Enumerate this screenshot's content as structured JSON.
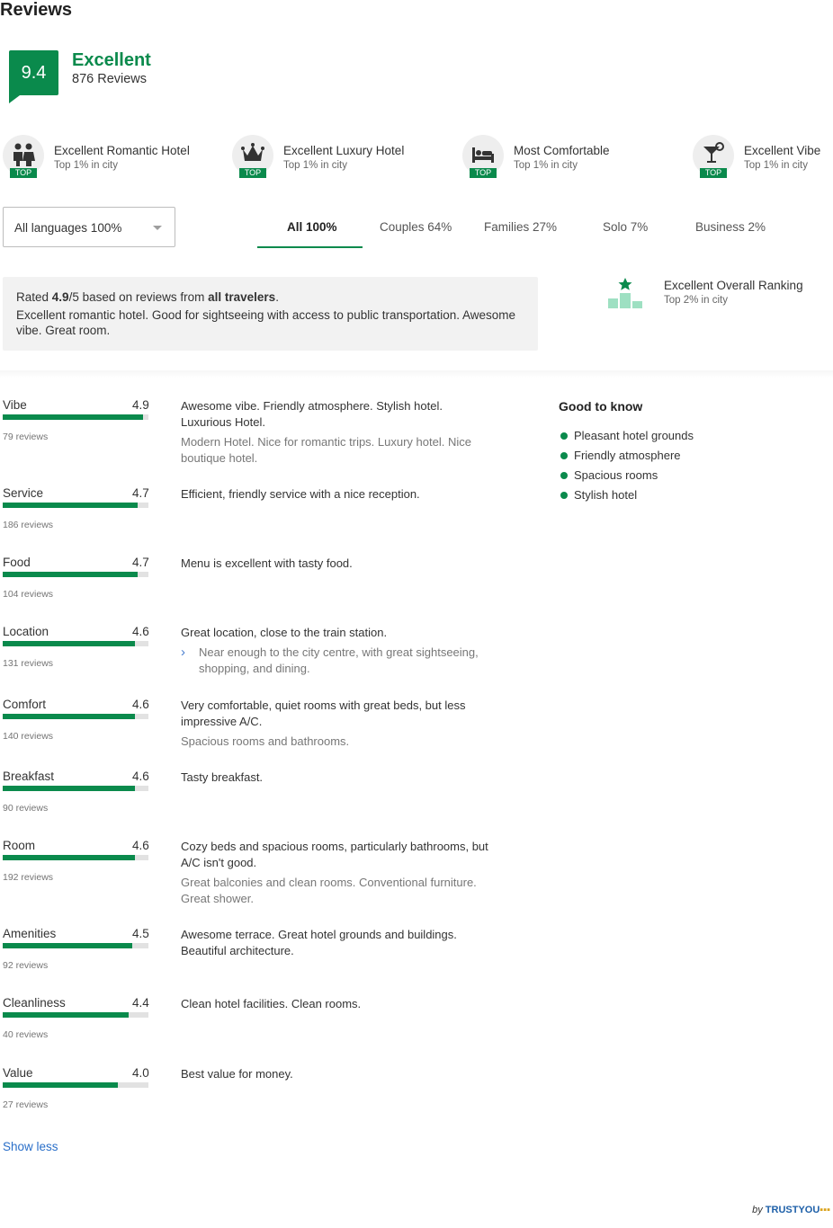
{
  "header": {
    "title": "Reviews",
    "score": "9.4",
    "score_label": "Excellent",
    "review_count": "876 Reviews"
  },
  "awards": [
    {
      "title": "Excellent Romantic Hotel",
      "subtitle": "Top 1% in city",
      "badge": "TOP",
      "icon": "couple-icon"
    },
    {
      "title": "Excellent Luxury Hotel",
      "subtitle": "Top 1% in city",
      "badge": "TOP",
      "icon": "crown-icon"
    },
    {
      "title": "Most Comfortable",
      "subtitle": "Top 1% in city",
      "badge": "TOP",
      "icon": "bed-icon"
    },
    {
      "title": "Excellent Vibe",
      "subtitle": "Top 1% in city",
      "badge": "TOP",
      "icon": "cocktail-icon"
    }
  ],
  "filters": {
    "language_select": "All languages 100%",
    "tabs": [
      {
        "label": "All 100%",
        "active": true
      },
      {
        "label": "Couples 64%",
        "active": false
      },
      {
        "label": "Families 27%",
        "active": false
      },
      {
        "label": "Solo 7%",
        "active": false
      },
      {
        "label": "Business 2%",
        "active": false
      }
    ]
  },
  "summary": {
    "rated_prefix": "Rated ",
    "rating": "4.9",
    "rated_mid": "/5 based on reviews from ",
    "audience": "all travelers",
    "rated_suffix": ".",
    "text": "Excellent romantic hotel. Good for sightseeing with access to public transportation. Awesome vibe. Great room."
  },
  "ranking": {
    "title": "Excellent Overall Ranking",
    "subtitle": "Top 2% in city",
    "icon": "podium-star-icon"
  },
  "categories": [
    {
      "name": "Vibe",
      "score": "4.9",
      "score_value": 4.9,
      "count": "79 reviews",
      "primary": "Awesome vibe. Friendly atmosphere. Stylish hotel. Luxurious Hotel.",
      "secondary": "Modern Hotel. Nice for romantic trips. Luxury hotel. Nice boutique hotel."
    },
    {
      "name": "Service",
      "score": "4.7",
      "score_value": 4.7,
      "count": "186 reviews",
      "primary": "Efficient, friendly service with a nice reception."
    },
    {
      "name": "Food",
      "score": "4.7",
      "score_value": 4.7,
      "count": "104 reviews",
      "primary": "Menu is excellent with tasty food."
    },
    {
      "name": "Location",
      "score": "4.6",
      "score_value": 4.6,
      "count": "131 reviews",
      "primary": "Great location, close to the train station.",
      "expand": "Near enough to the city centre, with great sightseeing, shopping, and dining."
    },
    {
      "name": "Comfort",
      "score": "4.6",
      "score_value": 4.6,
      "count": "140 reviews",
      "primary": "Very comfortable, quiet rooms with great beds, but less impressive A/C.",
      "secondary": "Spacious rooms and bathrooms."
    },
    {
      "name": "Breakfast",
      "score": "4.6",
      "score_value": 4.6,
      "count": "90 reviews",
      "primary": "Tasty breakfast."
    },
    {
      "name": "Room",
      "score": "4.6",
      "score_value": 4.6,
      "count": "192 reviews",
      "primary": "Cozy beds and spacious rooms, particularly bathrooms, but A/C isn't good.",
      "secondary": "Great balconies and clean rooms. Conventional furniture. Great shower."
    },
    {
      "name": "Amenities",
      "score": "4.5",
      "score_value": 4.5,
      "count": "92 reviews",
      "primary": "Awesome terrace. Great hotel grounds and buildings. Beautiful architecture."
    },
    {
      "name": "Cleanliness",
      "score": "4.4",
      "score_value": 4.4,
      "count": "40 reviews",
      "primary": "Clean hotel facilities. Clean rooms."
    },
    {
      "name": "Value",
      "score": "4.0",
      "score_value": 4.0,
      "count": "27 reviews",
      "primary": "Best value for money."
    }
  ],
  "good_to_know": {
    "title": "Good to know",
    "items": [
      "Pleasant hotel grounds",
      "Friendly atmosphere",
      "Spacious rooms",
      "Stylish hotel"
    ]
  },
  "footer": {
    "show_less": "Show less",
    "by": "by",
    "brand": "TRUSTYOU"
  },
  "colors": {
    "accent": "#0a8a4c",
    "link": "#2a6fc9",
    "summary_bg": "#f2f2f2"
  }
}
